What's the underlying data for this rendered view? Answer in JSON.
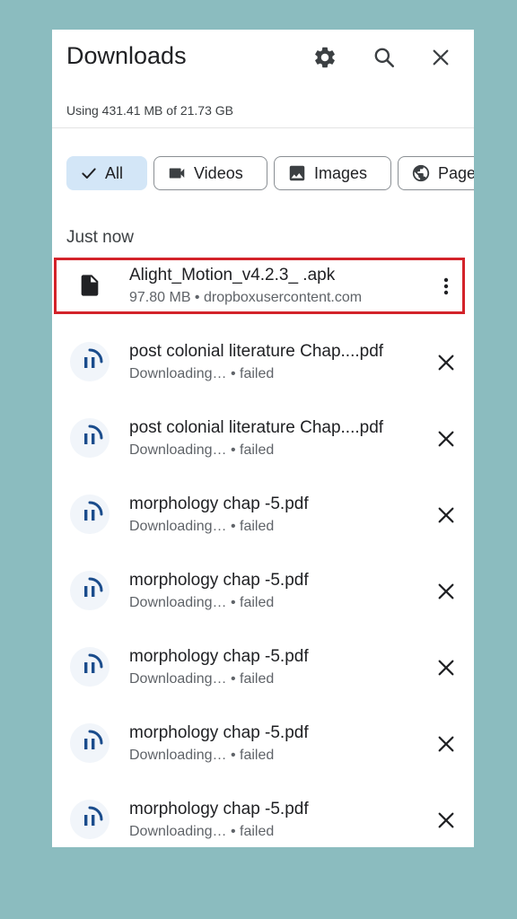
{
  "header": {
    "title": "Downloads",
    "storage": "Using 431.41 MB of 21.73 GB",
    "icons": [
      "gear-icon",
      "search-icon",
      "close-icon"
    ]
  },
  "filters": {
    "all": "All",
    "videos": "Videos",
    "images": "Images",
    "pages": "Page"
  },
  "section": {
    "label": "Just now"
  },
  "items": [
    {
      "name": "Alight_Motion_v4.2.3_ .apk",
      "sub": "97.80 MB • dropboxusercontent.com",
      "action": "more-vert-icon"
    },
    {
      "name": "post colonial literature Chap....pdf",
      "status": "Downloading…",
      "result": " • failed",
      "action": "close-icon"
    },
    {
      "name": "post colonial literature Chap....pdf",
      "status": "Downloading…",
      "result": " • failed",
      "action": "close-icon"
    },
    {
      "name": "morphology chap -5.pdf",
      "status": "Downloading…",
      "result": " • failed",
      "action": "close-icon"
    },
    {
      "name": "morphology chap -5.pdf",
      "status": "Downloading…",
      "result": " • failed",
      "action": "close-icon"
    },
    {
      "name": "morphology chap -5.pdf",
      "status": "Downloading…",
      "result": " • failed",
      "action": "close-icon"
    },
    {
      "name": "morphology chap -5.pdf",
      "status": "Downloading…",
      "result": " • failed",
      "action": "close-icon"
    },
    {
      "name": "morphology chap -5.pdf",
      "status": "Downloading…",
      "result": " • failed",
      "action": "close-icon"
    }
  ],
  "colors": {
    "background": "#8bbcbf",
    "highlight": "#d3232a",
    "accent": "#1a4c8c",
    "chip_active": "#d3e6f7"
  }
}
